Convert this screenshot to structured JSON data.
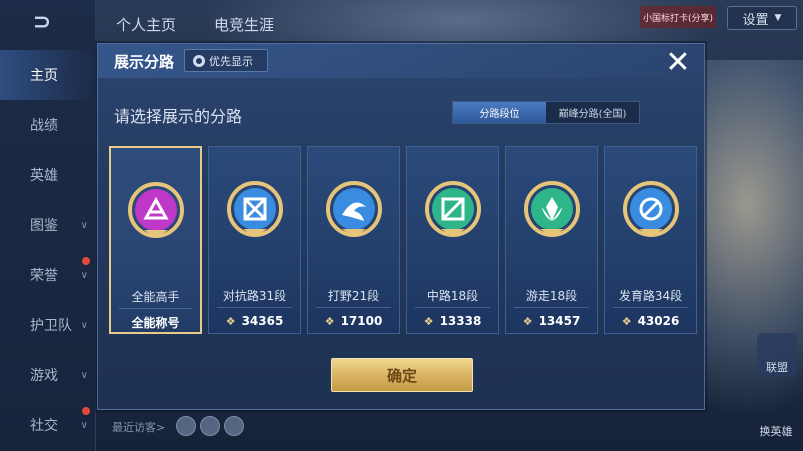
{
  "background": {
    "back_glyph": "⊃",
    "top_tabs": [
      "个人主页",
      "电竞生涯"
    ],
    "settings_label": "设置",
    "top_badge": "小国标打卡(分享)",
    "sidebar_items": [
      {
        "label": "主页",
        "chevron": ""
      },
      {
        "label": "战绩",
        "chevron": ""
      },
      {
        "label": "英雄",
        "chevron": ""
      },
      {
        "label": "图鉴",
        "chevron": "∨"
      },
      {
        "label": "荣誉",
        "chevron": "∨"
      },
      {
        "label": "护卫队",
        "chevron": "∨"
      },
      {
        "label": "游戏",
        "chevron": "∨"
      },
      {
        "label": "社交",
        "chevron": "∨"
      }
    ],
    "visitors_label": "最近访客>",
    "right_button": "联盟",
    "swap_hero": "换英雄"
  },
  "modal": {
    "title": "展示分路",
    "priority_label": "优先显示",
    "close_glyph": "✕",
    "prompt": "请选择展示的分路",
    "segments": [
      "分路段位",
      "巅峰分路(全国)"
    ],
    "confirm_label": "确定",
    "cards": [
      {
        "name": "全能高手",
        "title_label": "全能称号",
        "points": "",
        "color": "#c038c8",
        "icon": "allround-emblem-icon"
      },
      {
        "name": "对抗路31段",
        "title_label": "",
        "points": "34365",
        "color": "#3a8ce0",
        "icon": "clash-lane-emblem-icon"
      },
      {
        "name": "打野21段",
        "title_label": "",
        "points": "17100",
        "color": "#3a8ce0",
        "icon": "jungle-emblem-icon"
      },
      {
        "name": "中路18段",
        "title_label": "",
        "points": "13338",
        "color": "#2fb58a",
        "icon": "mid-lane-emblem-icon"
      },
      {
        "name": "游走18段",
        "title_label": "",
        "points": "13457",
        "color": "#2fb58a",
        "icon": "roam-emblem-icon"
      },
      {
        "name": "发育路34段",
        "title_label": "",
        "points": "43026",
        "color": "#3a8ce0",
        "icon": "farm-lane-emblem-icon"
      }
    ],
    "points_icon_glyph": "❖"
  },
  "colors": {
    "selected_border": "#e9c98a",
    "confirm_gold": "#d9b564",
    "segment_active": "#4a7ac0"
  }
}
